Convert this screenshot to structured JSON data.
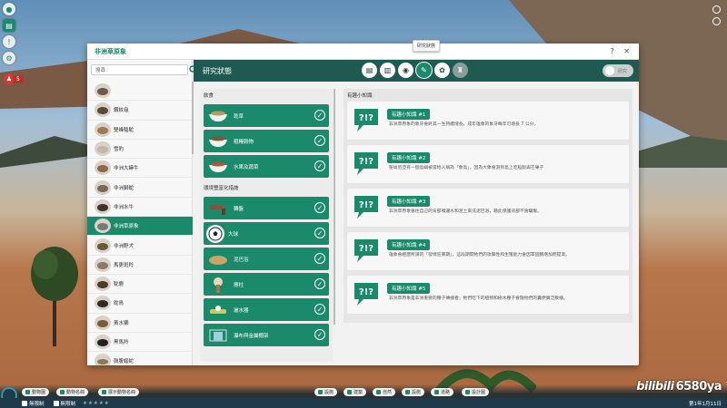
{
  "hud": {
    "money_value": "5"
  },
  "window": {
    "title": "非洲草原象",
    "controls": "? ✕",
    "tooltip": "研究狀態"
  },
  "list": {
    "search_placeholder": "搜尋",
    "animals": [
      {
        "name": "",
        "active": false
      },
      {
        "name": "鑽紋龜",
        "active": false
      },
      {
        "name": "雙峰駱駝",
        "active": false
      },
      {
        "name": "雪豹",
        "active": false
      },
      {
        "name": "非洲大蟒牛",
        "active": false
      },
      {
        "name": "非洲獅鴕",
        "active": false
      },
      {
        "name": "非洲水牛",
        "active": false
      },
      {
        "name": "非洲草原象",
        "active": true
      },
      {
        "name": "非洲野犬",
        "active": false
      },
      {
        "name": "馬更斑羚",
        "active": false
      },
      {
        "name": "駝鹿",
        "active": false
      },
      {
        "name": "鴕鳥",
        "active": false
      },
      {
        "name": "黃水獺",
        "active": false
      },
      {
        "name": "黑馬羚",
        "active": false
      },
      {
        "name": "鼓腹蝰蛇",
        "active": false
      }
    ]
  },
  "band": {
    "title": "研究狀態",
    "button_label": "研究",
    "tabs": [
      "document-icon",
      "chart-icon",
      "drop-icon",
      "facts-icon",
      "paw-icon",
      "trophy-icon"
    ]
  },
  "diet": {
    "header": "飲食",
    "items": [
      "乾草",
      "粗糧穀物",
      "水果及蔬菜"
    ]
  },
  "enrichment": {
    "header": "環境豐富化措施",
    "items": [
      "轉盤",
      "大球",
      "泥巴浴",
      "擦柱",
      "灑水器",
      "瀑布與金屬棚架"
    ]
  },
  "facts": {
    "header": "有趣小知識",
    "items": [
      {
        "title": "有趣小知識 #1",
        "body": "非洲草原象的象牙會終其一生持續增長，成年雄象的象牙每年可增長 7 公分。"
      },
      {
        "title": "有趣小知識 #2",
        "body": "聖尚尼亞有一個島嶼被當地人稱為「象島」，因為大象會游到島上吃稻穀與芒果子"
      },
      {
        "title": "有趣小知識 #3",
        "body": "非洲草原象會往自己的背部噴灑水和泥土來洗泥巴浴，藉此保護背部不會曬傷。"
      },
      {
        "title": "有趣小知識 #4",
        "body": "雄象會經歷所謂的「發情狂暴期」，這段期間牠們的攻擊性和生殖能力會因睪固酮增加而提高。"
      },
      {
        "title": "有趣小知識 #5",
        "body": "非洲草原象是非洲重要的種子傳播者；牠們吃下的植物和樹木種子會隨牠們的糞便廣泛散播。"
      }
    ]
  },
  "bottom": {
    "left_buttons": [
      "動物園",
      "動物名冊",
      "展示動物名冊"
    ],
    "center_buttons": [
      "設施",
      "建築",
      "自然",
      "設施",
      "道路",
      "設計圖"
    ],
    "status_a": "無限制",
    "status_b": "無限制",
    "date": "第1年1月11日",
    "watermark_brand": "bilibili",
    "watermark_text": "6580ya"
  }
}
